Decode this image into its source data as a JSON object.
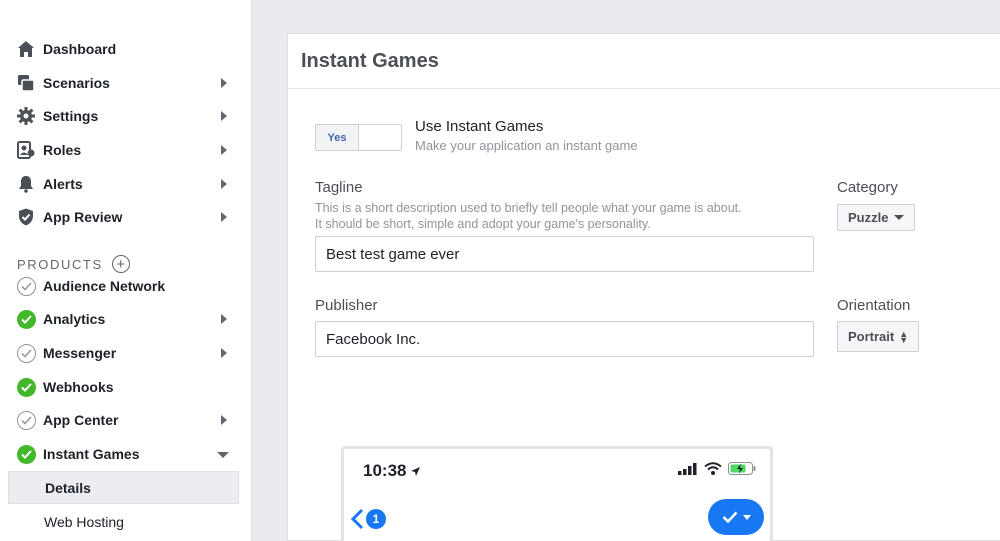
{
  "sidebar": {
    "items": [
      {
        "label": "Dashboard",
        "icon": "home-icon"
      },
      {
        "label": "Scenarios",
        "icon": "scenarios-icon"
      },
      {
        "label": "Settings",
        "icon": "gear-icon"
      },
      {
        "label": "Roles",
        "icon": "roles-icon"
      },
      {
        "label": "Alerts",
        "icon": "bell-icon"
      },
      {
        "label": "App Review",
        "icon": "shield-icon"
      }
    ],
    "products_header": "PRODUCTS",
    "add_product": "+",
    "products": [
      {
        "label": "Audience Network",
        "status": "not-configured"
      },
      {
        "label": "Analytics",
        "status": "configured"
      },
      {
        "label": "Messenger",
        "status": "not-configured"
      },
      {
        "label": "Webhooks",
        "status": "configured"
      },
      {
        "label": "App Center",
        "status": "not-configured"
      },
      {
        "label": "Instant Games",
        "status": "configured"
      }
    ],
    "subitems": [
      {
        "label": "Details",
        "active": true
      },
      {
        "label": "Web Hosting",
        "active": false
      }
    ]
  },
  "main": {
    "title": "Instant Games",
    "toggle": {
      "on_label": "Yes"
    },
    "use_instant_games": {
      "title": "Use Instant Games",
      "description": "Make your application an instant game"
    },
    "tagline": {
      "label": "Tagline",
      "help_line1": "This is a short description used to briefly tell people what your game is about.",
      "help_line2": "It should be short, simple and adopt your game's personality.",
      "value": "Best test game ever"
    },
    "category": {
      "label": "Category",
      "value": "Puzzle"
    },
    "publisher": {
      "label": "Publisher",
      "value": "Facebook Inc."
    },
    "orientation": {
      "label": "Orientation",
      "value": "Portrait"
    }
  },
  "phone_preview": {
    "time": "10:38",
    "back_badge": "1"
  },
  "colors": {
    "success": "#42b72a",
    "accent": "#1877f2",
    "link": "#4267b2"
  }
}
